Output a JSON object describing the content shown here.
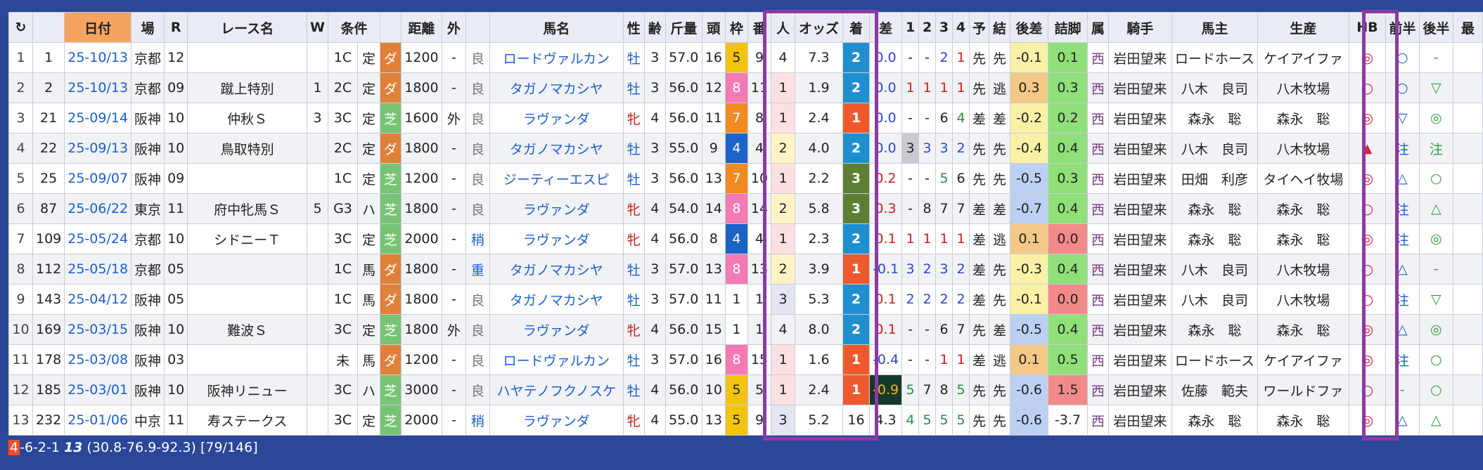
{
  "headers": [
    "↻",
    "日付",
    "場",
    "R",
    "レース名",
    "W",
    "条件",
    "",
    "距離",
    "外",
    "",
    "馬名",
    "性",
    "齢",
    "斤量",
    "頭",
    "枠",
    "番",
    "人",
    "オッズ",
    "着",
    "差",
    "1",
    "2",
    "3",
    "4",
    "予",
    "結",
    "後差",
    "詰脚",
    "属",
    "騎手",
    "馬主",
    "生産",
    "HB",
    "前半",
    "後半",
    "最"
  ],
  "rows": [
    {
      "n": "1",
      "id": "1",
      "date": "25-10/13",
      "place": "京都",
      "r": "12",
      "race": "",
      "w": "",
      "cls": "1C",
      "hc": "定",
      "surf": "ダ",
      "sc": "d",
      "dist": "1200",
      "out": "-",
      "cond": "良",
      "horse": "ロードヴァルカン",
      "sex": "牡",
      "sx": "m",
      "age": "3",
      "kg": "57.0",
      "heads": "16",
      "waku": "5",
      "bc": "b5",
      "ban": "9",
      "pop": "4",
      "pc": "",
      "odds": "7.3",
      "fin": "2",
      "fc": "fin2",
      "diff": "0.0",
      "dc": "diff-blue",
      "c1": "-",
      "c1c": "",
      "c2": "-",
      "c2c": "",
      "c3": "2",
      "c3c": "cor-blue",
      "c4": "1",
      "c4c": "cor-red",
      "yo": "先",
      "ke": "先",
      "kosa": "-0.1",
      "kc": "kb-yel",
      "tsume": "0.1",
      "tc": "tf-grn",
      "zoku": "西",
      "jockey": "岩田望来",
      "owner": "ロードホース",
      "breeder": "ケイアイファ",
      "hb": "◎",
      "hbc": "hb-red",
      "zen": "○",
      "zc": "mk-blue",
      "kou": "-",
      "koc": "mk-gray"
    },
    {
      "n": "2",
      "id": "2",
      "date": "25-10/13",
      "place": "京都",
      "r": "09",
      "race": "蹴上特別",
      "w": "1",
      "cls": "2C",
      "hc": "定",
      "surf": "ダ",
      "sc": "d",
      "dist": "1800",
      "out": "-",
      "cond": "良",
      "horse": "タガノマカシヤ",
      "sex": "牡",
      "sx": "m",
      "age": "3",
      "kg": "56.0",
      "heads": "12",
      "waku": "8",
      "bc": "b8",
      "ban": "11",
      "pop": "1",
      "pc": "pop1",
      "odds": "1.9",
      "fin": "2",
      "fc": "fin2",
      "diff": "0.0",
      "dc": "diff-blue",
      "c1": "1",
      "c1c": "cor-red",
      "c2": "1",
      "c2c": "cor-red",
      "c3": "1",
      "c3c": "cor-red",
      "c4": "1",
      "c4c": "cor-red",
      "yo": "先",
      "ke": "逃",
      "kosa": "0.3",
      "kc": "kb-org",
      "tsume": "0.3",
      "tc": "tf-grn",
      "zoku": "西",
      "jockey": "岩田望来",
      "owner": "八木　良司",
      "breeder": "八木牧場",
      "hb": "○",
      "hbc": "hb-red",
      "zen": "○",
      "zc": "mk-blue",
      "kou": "▽",
      "koc": "mk-green"
    },
    {
      "n": "3",
      "id": "21",
      "date": "25-09/14",
      "place": "阪神",
      "r": "10",
      "race": "仲秋Ｓ",
      "w": "3",
      "cls": "3C",
      "hc": "定",
      "surf": "芝",
      "sc": "t",
      "dist": "1600",
      "out": "外",
      "cond": "良",
      "horse": "ラヴァンダ",
      "sex": "牝",
      "sx": "f",
      "age": "4",
      "kg": "56.0",
      "heads": "11",
      "waku": "7",
      "bc": "b7",
      "ban": "8",
      "pop": "1",
      "pc": "pop1",
      "odds": "2.4",
      "fin": "1",
      "fc": "fin1",
      "diff": "0.0",
      "dc": "diff-blue",
      "c1": "-",
      "c1c": "",
      "c2": "-",
      "c2c": "",
      "c3": "6",
      "c3c": "",
      "c4": "4",
      "c4c": "cor-green",
      "yo": "差",
      "ke": "差",
      "kosa": "-0.2",
      "kc": "kb-yel",
      "tsume": "0.2",
      "tc": "tf-grn",
      "zoku": "西",
      "jockey": "岩田望来",
      "owner": "森永　聡",
      "breeder": "森永　聡",
      "hb": "◎",
      "hbc": "hb-red",
      "zen": "▽",
      "zc": "mk-blue",
      "kou": "◎",
      "koc": "mk-green"
    },
    {
      "n": "4",
      "id": "22",
      "date": "25-09/13",
      "place": "阪神",
      "r": "10",
      "race": "鳥取特別",
      "w": "",
      "cls": "2C",
      "hc": "定",
      "surf": "ダ",
      "sc": "d",
      "dist": "1800",
      "out": "-",
      "cond": "良",
      "horse": "タガノマカシヤ",
      "sex": "牡",
      "sx": "m",
      "age": "3",
      "kg": "55.0",
      "heads": "9",
      "waku": "4",
      "bc": "b4",
      "ban": "4",
      "pop": "2",
      "pc": "pop2",
      "odds": "4.0",
      "fin": "2",
      "fc": "fin2",
      "diff": "0.0",
      "dc": "diff-blue",
      "c1": "3",
      "c1c": "cor-gray",
      "c2": "3",
      "c2c": "cor-blue",
      "c3": "3",
      "c3c": "cor-blue",
      "c4": "2",
      "c4c": "cor-blue",
      "yo": "先",
      "ke": "先",
      "kosa": "-0.4",
      "kc": "kb-yel",
      "tsume": "0.4",
      "tc": "tf-grn",
      "zoku": "西",
      "jockey": "岩田望来",
      "owner": "八木　良司",
      "breeder": "八木牧場",
      "hb": "▲",
      "hbc": "hb-tri",
      "zen": "注",
      "zc": "mk-blue",
      "kou": "注",
      "koc": "mk-green"
    },
    {
      "n": "5",
      "id": "25",
      "date": "25-09/07",
      "place": "阪神",
      "r": "09",
      "race": "",
      "w": "",
      "cls": "1C",
      "hc": "定",
      "surf": "芝",
      "sc": "t",
      "dist": "1200",
      "out": "-",
      "cond": "良",
      "horse": "ジーティーエスピ",
      "sex": "牡",
      "sx": "m",
      "age": "3",
      "kg": "56.0",
      "heads": "13",
      "waku": "7",
      "bc": "b7",
      "ban": "10",
      "pop": "1",
      "pc": "pop1",
      "odds": "2.2",
      "fin": "3",
      "fc": "fin3",
      "diff": "0.2",
      "dc": "diff-red",
      "c1": "-",
      "c1c": "",
      "c2": "-",
      "c2c": "",
      "c3": "5",
      "c3c": "cor-green",
      "c4": "6",
      "c4c": "",
      "yo": "先",
      "ke": "先",
      "kosa": "-0.5",
      "kc": "kb-blu",
      "tsume": "0.3",
      "tc": "tf-grn",
      "zoku": "西",
      "jockey": "岩田望来",
      "owner": "田畑　利彦",
      "breeder": "タイヘイ牧場",
      "hb": "◎",
      "hbc": "hb-red",
      "zen": "△",
      "zc": "mk-blue",
      "kou": "○",
      "koc": "mk-green"
    },
    {
      "n": "6",
      "id": "87",
      "date": "25-06/22",
      "place": "東京",
      "r": "11",
      "race": "府中牝馬Ｓ",
      "w": "5",
      "cls": "G3",
      "hc": "ハ",
      "surf": "芝",
      "sc": "t",
      "dist": "1800",
      "out": "-",
      "cond": "良",
      "horse": "ラヴァンダ",
      "sex": "牝",
      "sx": "f",
      "age": "4",
      "kg": "54.0",
      "heads": "14",
      "waku": "8",
      "bc": "b8",
      "ban": "14",
      "pop": "2",
      "pc": "pop2",
      "odds": "5.8",
      "fin": "3",
      "fc": "fin3",
      "diff": "0.3",
      "dc": "diff-red",
      "c1": "-",
      "c1c": "",
      "c2": "8",
      "c2c": "",
      "c3": "7",
      "c3c": "",
      "c4": "7",
      "c4c": "",
      "yo": "差",
      "ke": "差",
      "kosa": "-0.7",
      "kc": "kb-blu",
      "tsume": "0.4",
      "tc": "tf-grn",
      "zoku": "西",
      "jockey": "岩田望来",
      "owner": "森永　聡",
      "breeder": "森永　聡",
      "hb": "○",
      "hbc": "hb-red",
      "zen": "注",
      "zc": "mk-blue",
      "kou": "△",
      "koc": "mk-green"
    },
    {
      "n": "7",
      "id": "109",
      "date": "25-05/24",
      "place": "京都",
      "r": "10",
      "race": "シドニーＴ",
      "w": "",
      "cls": "3C",
      "hc": "定",
      "surf": "芝",
      "sc": "t",
      "dist": "2000",
      "out": "-",
      "cond": "稍",
      "horse": "ラヴァンダ",
      "sex": "牝",
      "sx": "f",
      "age": "4",
      "kg": "56.0",
      "heads": "8",
      "waku": "4",
      "bc": "b4",
      "ban": "4",
      "pop": "1",
      "pc": "pop1",
      "odds": "2.3",
      "fin": "2",
      "fc": "fin2",
      "diff": "0.1",
      "dc": "diff-red",
      "c1": "1",
      "c1c": "cor-red",
      "c2": "1",
      "c2c": "cor-red",
      "c3": "1",
      "c3c": "cor-red",
      "c4": "1",
      "c4c": "cor-red",
      "yo": "差",
      "ke": "逃",
      "kosa": "0.1",
      "kc": "kb-org",
      "tsume": "0.0",
      "tc": "tf-red",
      "zoku": "西",
      "jockey": "岩田望来",
      "owner": "森永　聡",
      "breeder": "森永　聡",
      "hb": "◎",
      "hbc": "hb-red",
      "zen": "注",
      "zc": "mk-blue",
      "kou": "◎",
      "koc": "mk-green"
    },
    {
      "n": "8",
      "id": "112",
      "date": "25-05/18",
      "place": "京都",
      "r": "05",
      "race": "",
      "w": "",
      "cls": "1C",
      "hc": "馬",
      "surf": "ダ",
      "sc": "d",
      "dist": "1800",
      "out": "-",
      "cond": "重",
      "horse": "タガノマカシヤ",
      "sex": "牡",
      "sx": "m",
      "age": "3",
      "kg": "57.0",
      "heads": "13",
      "waku": "8",
      "bc": "b8",
      "ban": "13",
      "pop": "2",
      "pc": "pop2",
      "odds": "3.9",
      "fin": "1",
      "fc": "fin1",
      "diff": "-0.1",
      "dc": "diff-blue",
      "c1": "3",
      "c1c": "cor-blue",
      "c2": "2",
      "c2c": "cor-blue",
      "c3": "3",
      "c3c": "cor-blue",
      "c4": "2",
      "c4c": "cor-blue",
      "yo": "差",
      "ke": "先",
      "kosa": "-0.3",
      "kc": "kb-yel",
      "tsume": "0.4",
      "tc": "tf-grn",
      "zoku": "西",
      "jockey": "岩田望来",
      "owner": "八木　良司",
      "breeder": "八木牧場",
      "hb": "○",
      "hbc": "hb-red",
      "zen": "△",
      "zc": "mk-blue",
      "kou": "-",
      "koc": "mk-gray"
    },
    {
      "n": "9",
      "id": "143",
      "date": "25-04/12",
      "place": "阪神",
      "r": "05",
      "race": "",
      "w": "",
      "cls": "1C",
      "hc": "馬",
      "surf": "ダ",
      "sc": "d",
      "dist": "1800",
      "out": "-",
      "cond": "良",
      "horse": "タガノマカシヤ",
      "sex": "牡",
      "sx": "m",
      "age": "3",
      "kg": "57.0",
      "heads": "11",
      "waku": "1",
      "bc": "b1",
      "ban": "1",
      "pop": "3",
      "pc": "pop3",
      "odds": "5.3",
      "fin": "2",
      "fc": "fin2",
      "diff": "0.1",
      "dc": "diff-red",
      "c1": "2",
      "c1c": "cor-blue",
      "c2": "2",
      "c2c": "cor-blue",
      "c3": "2",
      "c3c": "cor-blue",
      "c4": "2",
      "c4c": "cor-blue",
      "yo": "差",
      "ke": "先",
      "kosa": "-0.1",
      "kc": "kb-yel",
      "tsume": "0.0",
      "tc": "tf-red",
      "zoku": "西",
      "jockey": "岩田望来",
      "owner": "八木　良司",
      "breeder": "八木牧場",
      "hb": "○",
      "hbc": "hb-red",
      "zen": "注",
      "zc": "mk-blue",
      "kou": "▽",
      "koc": "mk-green"
    },
    {
      "n": "10",
      "id": "169",
      "date": "25-03/15",
      "place": "阪神",
      "r": "10",
      "race": "難波Ｓ",
      "w": "",
      "cls": "3C",
      "hc": "定",
      "surf": "芝",
      "sc": "t",
      "dist": "1800",
      "out": "外",
      "cond": "良",
      "horse": "ラヴァンダ",
      "sex": "牝",
      "sx": "f",
      "age": "4",
      "kg": "56.0",
      "heads": "15",
      "waku": "1",
      "bc": "b1",
      "ban": "1",
      "pop": "4",
      "pc": "",
      "odds": "8.0",
      "fin": "2",
      "fc": "fin2",
      "diff": "0.1",
      "dc": "diff-red",
      "c1": "-",
      "c1c": "",
      "c2": "-",
      "c2c": "",
      "c3": "6",
      "c3c": "",
      "c4": "7",
      "c4c": "",
      "yo": "先",
      "ke": "差",
      "kosa": "-0.5",
      "kc": "kb-blu",
      "tsume": "0.4",
      "tc": "tf-grn",
      "zoku": "西",
      "jockey": "岩田望来",
      "owner": "森永　聡",
      "breeder": "森永　聡",
      "hb": "◎",
      "hbc": "hb-red",
      "zen": "△",
      "zc": "mk-blue",
      "kou": "◎",
      "koc": "mk-green"
    },
    {
      "n": "11",
      "id": "178",
      "date": "25-03/08",
      "place": "阪神",
      "r": "03",
      "race": "",
      "w": "",
      "cls": "未",
      "hc": "馬",
      "surf": "ダ",
      "sc": "d",
      "dist": "1200",
      "out": "-",
      "cond": "良",
      "horse": "ロードヴァルカン",
      "sex": "牡",
      "sx": "m",
      "age": "3",
      "kg": "57.0",
      "heads": "16",
      "waku": "8",
      "bc": "b8",
      "ban": "15",
      "pop": "1",
      "pc": "pop1",
      "odds": "1.6",
      "fin": "1",
      "fc": "fin1",
      "diff": "-0.4",
      "dc": "diff-blue",
      "c1": "-",
      "c1c": "",
      "c2": "-",
      "c2c": "",
      "c3": "1",
      "c3c": "cor-red",
      "c4": "1",
      "c4c": "cor-red",
      "yo": "差",
      "ke": "逃",
      "kosa": "0.1",
      "kc": "kb-org",
      "tsume": "0.5",
      "tc": "tf-grn",
      "zoku": "西",
      "jockey": "岩田望来",
      "owner": "ロードホース",
      "breeder": "ケイアイファ",
      "hb": "◎",
      "hbc": "hb-red",
      "zen": "注",
      "zc": "mk-blue",
      "kou": "○",
      "koc": "mk-green"
    },
    {
      "n": "12",
      "id": "185",
      "date": "25-03/01",
      "place": "阪神",
      "r": "10",
      "race": "阪神リニュー",
      "w": "",
      "cls": "3C",
      "hc": "ハ",
      "surf": "芝",
      "sc": "t",
      "dist": "3000",
      "out": "-",
      "cond": "良",
      "horse": "ハヤテノフクノスケ",
      "sex": "牡",
      "sx": "m",
      "age": "4",
      "kg": "56.0",
      "heads": "10",
      "waku": "5",
      "bc": "b5",
      "ban": "5",
      "pop": "1",
      "pc": "pop1",
      "odds": "2.4",
      "fin": "1",
      "fc": "fin1",
      "diff": "-0.9",
      "dc": "diff-dark",
      "c1": "5",
      "c1c": "cor-green",
      "c2": "7",
      "c2c": "",
      "c3": "8",
      "c3c": "",
      "c4": "5",
      "c4c": "cor-green",
      "yo": "先",
      "ke": "先",
      "kosa": "-0.6",
      "kc": "kb-blu",
      "tsume": "1.5",
      "tc": "tf-red",
      "zoku": "西",
      "jockey": "岩田望来",
      "owner": "佐藤　範夫",
      "breeder": "ワールドファ",
      "hb": "○",
      "hbc": "hb-red",
      "zen": "-",
      "zc": "mk-gray",
      "kou": "○",
      "koc": "mk-green"
    },
    {
      "n": "13",
      "id": "232",
      "date": "25-01/06",
      "place": "中京",
      "r": "11",
      "race": "寿ステークス",
      "w": "",
      "cls": "3C",
      "hc": "定",
      "surf": "芝",
      "sc": "t",
      "dist": "2000",
      "out": "-",
      "cond": "稍",
      "horse": "ラヴァンダ",
      "sex": "牝",
      "sx": "f",
      "age": "4",
      "kg": "55.0",
      "heads": "13",
      "waku": "5",
      "bc": "b5",
      "ban": "9",
      "pop": "3",
      "pc": "pop3",
      "odds": "5.2",
      "fin": "16",
      "fc": "",
      "diff": "4.3",
      "dc": "diff-plain",
      "c1": "4",
      "c1c": "cor-green",
      "c2": "5",
      "c2c": "cor-green",
      "c3": "5",
      "c3c": "cor-green",
      "c4": "5",
      "c4c": "cor-green",
      "yo": "先",
      "ke": "先",
      "kosa": "-0.6",
      "kc": "kb-blu",
      "tsume": "-3.7",
      "tc": "tf-plain",
      "zoku": "西",
      "jockey": "岩田望来",
      "owner": "森永　聡",
      "breeder": "森永　聡",
      "hb": "◎",
      "hbc": "hb-red",
      "zen": "△",
      "zc": "mk-blue",
      "kou": "△",
      "koc": "mk-green"
    }
  ],
  "summary": {
    "first": "4",
    "rest": "-6-2-1 ",
    "bold": "13",
    "tail": " (30.8-76.9-92.3) [79/146]"
  },
  "colors": {
    "background": "#2b4797",
    "highlight_box": "#8c3aa3",
    "date_header": "#f4a460",
    "surface_dirt": "#e0813a",
    "surface_turf": "#76c474"
  }
}
